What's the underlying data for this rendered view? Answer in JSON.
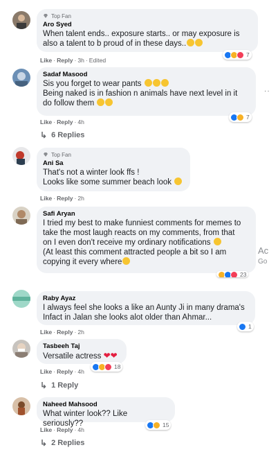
{
  "comments": [
    {
      "author": "Aro Syed",
      "badge": "Top Fan",
      "lines": [
        "When talent ends.. exposure starts.. or may exposure is",
        "also a talent to b proud of in these days.."
      ],
      "actions": {
        "like": "Like",
        "reply": "Reply",
        "time": "3h",
        "edited": "Edited"
      },
      "reaction_count": "7"
    },
    {
      "author": "Sadaf Masood",
      "lines": [
        "Sis you forget to wear pants",
        "Being naked is in fashion n animals have next level in it",
        "do follow them"
      ],
      "actions": {
        "like": "Like",
        "reply": "Reply",
        "time": "4h"
      },
      "reaction_count": "7",
      "replies": "6 Replies"
    },
    {
      "author": "Ani Sa",
      "badge": "Top Fan",
      "lines": [
        "That's not a winter look ffs !",
        "Looks like some summer beach look"
      ],
      "actions": {
        "like": "Like",
        "reply": "Reply",
        "time": "2h"
      }
    },
    {
      "author": "Safi Aryan",
      "lines": [
        "I tried my best to make funniest comments for memes to",
        "take the most laugh reacts on my comments, from that",
        "on I even don't receive my ordinary notifications",
        "(At least this comment attracted people a bit so I am",
        "copying it every where"
      ],
      "reaction_count": "23"
    },
    {
      "author": "Raby Ayaz",
      "lines": [
        "I always feel she looks a like an Aunty Ji in many drama's",
        "Infact in Jalan she looks alot older than Ahmar..."
      ],
      "actions": {
        "like": "Like",
        "reply": "Reply",
        "time": "2h"
      },
      "reaction_count": "1"
    },
    {
      "author": "Tasbeeh Taj",
      "lines": [
        "Versatile actress"
      ],
      "actions": {
        "like": "Like",
        "reply": "Reply",
        "time": "4h"
      },
      "reaction_count": "18",
      "replies": "1 Reply"
    },
    {
      "author": "Naheed Mahsood",
      "lines": [
        "What winter look?? Like seriously??"
      ],
      "actions": {
        "like": "Like",
        "reply": "Reply",
        "time": "4h"
      },
      "reaction_count": "15",
      "replies": "2 Replies"
    }
  ],
  "side": {
    "dots": "··",
    "ad": "Ac",
    "ad2": "Go"
  },
  "colors": {
    "like": "#1877f2",
    "haha": "#f7b125",
    "love": "#f33e58",
    "bubble": "#f0f2f5",
    "muted": "#65676b"
  }
}
